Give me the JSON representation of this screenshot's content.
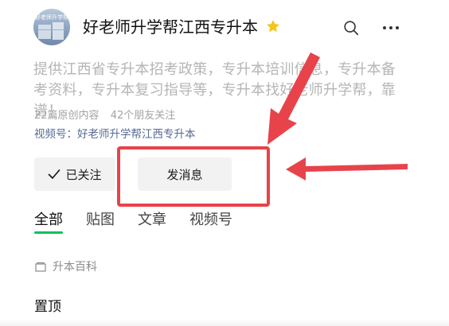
{
  "account": {
    "avatar_text": "好老师升学帮",
    "name": "好老师升学帮江西专升本",
    "star_icon": "star-icon",
    "star_color": "#f5c518"
  },
  "toolbar": {
    "search_icon": "search-icon",
    "more_icon": "more-icon"
  },
  "profile": {
    "description": "提供江西省专升本招考政策，专升本培训信息，专升本备考资料，专升本复习指导等，专升本找好老师升学帮，靠谱！",
    "original_count": "22篇原创内容",
    "friends_following": "42个朋友关注",
    "video_channel": "视频号：好老师升学帮江西专升本"
  },
  "actions": {
    "followed_label": "已关注",
    "message_label": "发消息"
  },
  "tabs": [
    {
      "label": "全部",
      "active": true
    },
    {
      "label": "贴图",
      "active": false
    },
    {
      "label": "文章",
      "active": false
    },
    {
      "label": "视频号",
      "active": false
    }
  ],
  "content": {
    "category_label": "升本百科",
    "pinned_label": "置顶"
  },
  "annotation": {
    "highlight_color": "#e8434b",
    "arrow_color": "#e8434b"
  },
  "colors": {
    "accent_green": "#07c160",
    "link_blue": "#576b95"
  }
}
